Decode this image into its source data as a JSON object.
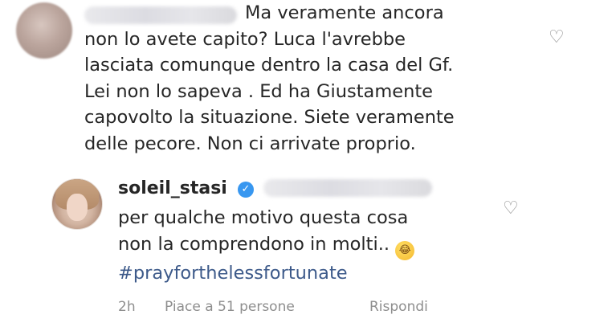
{
  "comments": {
    "first": {
      "lines": [
        "Ma veramente ancora",
        "non lo avete capito?  Luca l'avrebbe",
        "lasciata comunque dentro la casa del Gf.",
        "Lei non lo sapeva . Ed ha Giustamente",
        "capovolto la situazione.  Siete veramente",
        "delle pecore. Non ci arrivate proprio."
      ],
      "like_icon": "heart-outline-icon"
    },
    "reply": {
      "username": "soleil_stasi",
      "verified_icon": "verified-badge-icon",
      "lines": [
        "per qualche motivo questa cosa",
        "non la comprendono in molti.."
      ],
      "emoji": "face-with-tears-of-joy-emoji",
      "hashtag": "#prayforthelessfortunate",
      "like_icon": "heart-outline-icon",
      "meta": {
        "time": "2h",
        "likes": "Piace a 51 persone",
        "reply": "Rispondi"
      }
    }
  },
  "colors": {
    "text": "#262626",
    "meta": "#8e8e8e",
    "hashtag": "#3d5a8a",
    "verified": "#3897f0"
  }
}
